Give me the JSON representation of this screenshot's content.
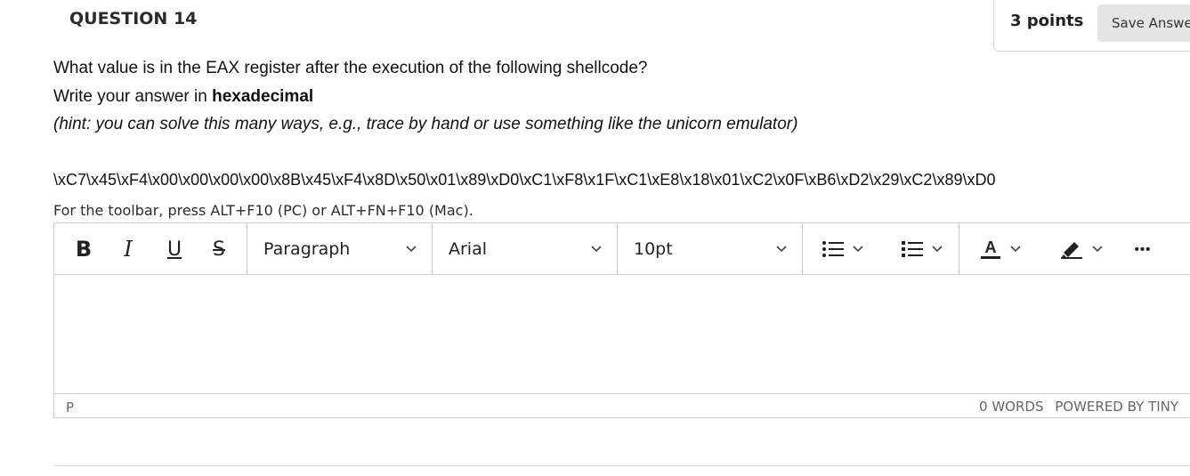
{
  "question": {
    "title": "QUESTION 14",
    "points": "3 points",
    "save_label": "Save Answer",
    "prompt": "What value is in the EAX register after the execution of the following shellcode?",
    "answer_format_prefix": "Write your answer in ",
    "answer_format_bold": "hexadecimal",
    "hint": "(hint: you can solve this many ways, e.g., trace by hand or use something like the unicorn emulator)",
    "shellcode": "\\xC7\\x45\\xF4\\x00\\x00\\x00\\x00\\x8B\\x45\\xF4\\x8D\\x50\\x01\\x89\\xD0\\xC1\\xF8\\x1F\\xC1\\xE8\\x18\\x01\\xC2\\x0F\\xB6\\xD2\\x29\\xC2\\x89\\xD0"
  },
  "editor": {
    "toolbar_hint": "For the toolbar, press ALT+F10 (PC) or ALT+FN+F10 (Mac).",
    "toolbar": {
      "bold": "B",
      "italic": "I",
      "underline": "U",
      "strikethrough": "S",
      "block_format": "Paragraph",
      "font_family": "Arial",
      "font_size": "10pt",
      "more": "•••"
    },
    "status": {
      "path": "P",
      "word_count": "0 WORDS",
      "powered_by": "POWERED BY TINY"
    },
    "icons": [
      "bullet-list-icon",
      "numbered-list-icon",
      "text-color-icon",
      "highlight-icon",
      "chevron-down-icon"
    ]
  }
}
